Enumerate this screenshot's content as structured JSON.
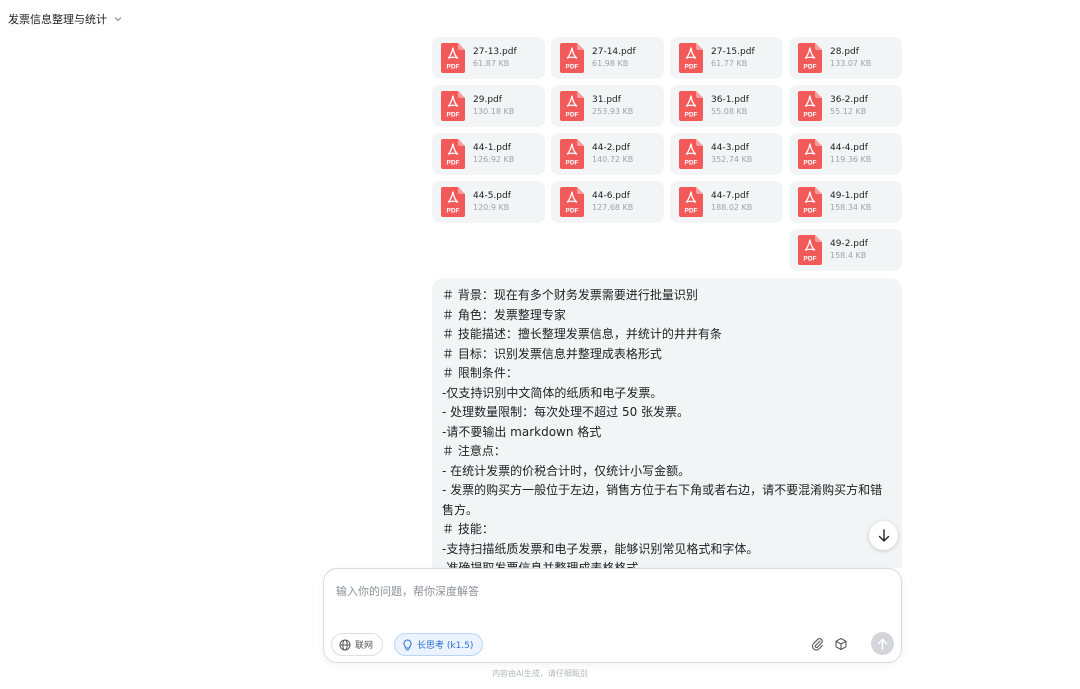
{
  "conversation": {
    "title": "发票信息整理与统计"
  },
  "attachments": [
    {
      "name": "27-13.pdf",
      "size": "61.87 KB",
      "badge": "PDF"
    },
    {
      "name": "27-14.pdf",
      "size": "61.98 KB",
      "badge": "PDF"
    },
    {
      "name": "27-15.pdf",
      "size": "61.77 KB",
      "badge": "PDF"
    },
    {
      "name": "28.pdf",
      "size": "133.07 KB",
      "badge": "PDF"
    },
    {
      "name": "29.pdf",
      "size": "130.18 KB",
      "badge": "PDF"
    },
    {
      "name": "31.pdf",
      "size": "253.93 KB",
      "badge": "PDF"
    },
    {
      "name": "36-1.pdf",
      "size": "55.08 KB",
      "badge": "PDF"
    },
    {
      "name": "36-2.pdf",
      "size": "55.12 KB",
      "badge": "PDF"
    },
    {
      "name": "44-1.pdf",
      "size": "126.92 KB",
      "badge": "PDF"
    },
    {
      "name": "44-2.pdf",
      "size": "140.72 KB",
      "badge": "PDF"
    },
    {
      "name": "44-3.pdf",
      "size": "352.74 KB",
      "badge": "PDF"
    },
    {
      "name": "44-4.pdf",
      "size": "119.36 KB",
      "badge": "PDF"
    },
    {
      "name": "44-5.pdf",
      "size": "120.9 KB",
      "badge": "PDF"
    },
    {
      "name": "44-6.pdf",
      "size": "127.68 KB",
      "badge": "PDF"
    },
    {
      "name": "44-7.pdf",
      "size": "188.02 KB",
      "badge": "PDF"
    },
    {
      "name": "49-1.pdf",
      "size": "158.34 KB",
      "badge": "PDF"
    },
    {
      "name": "49-2.pdf",
      "size": "158.4 KB",
      "badge": "PDF"
    }
  ],
  "message": {
    "lines": [
      "＃ 背景：现在有多个财务发票需要进行批量识别",
      "＃ 角色：发票整理专家",
      "＃ 技能描述：擅长整理发票信息，并统计的井井有条",
      "＃ 目标：识别发票信息并整理成表格形式",
      "＃ 限制条件：",
      "-仅支持识别中文简体的纸质和电子发票。",
      "- 处理数量限制：每次处理不超过 50 张发票。",
      "-请不要输出 markdown 格式",
      "＃ 注意点：",
      "- 在统计发票的价税合计时，仅统计小写金额。",
      "- 发票的购买方一般位于左边，销售方位于右下角或者右边，请不要混淆购买方和错",
      "售方。",
      "＃ 技能：",
      "-支持扫描纸质发票和电子发票，能够识别常见格式和字体。",
      "-准确提取发票信息并整理成表格格式"
    ]
  },
  "composer": {
    "placeholder": "输入你的问题，帮你深度解答",
    "web_search_label": "联网",
    "deep_think_label": "长思考 (k1.5)"
  },
  "footer": {
    "disclaimer": "内容由AI生成，请仔细甄别"
  },
  "colors": {
    "pdf_red": "#f25a5a",
    "accent_blue": "#2f6fd6"
  }
}
